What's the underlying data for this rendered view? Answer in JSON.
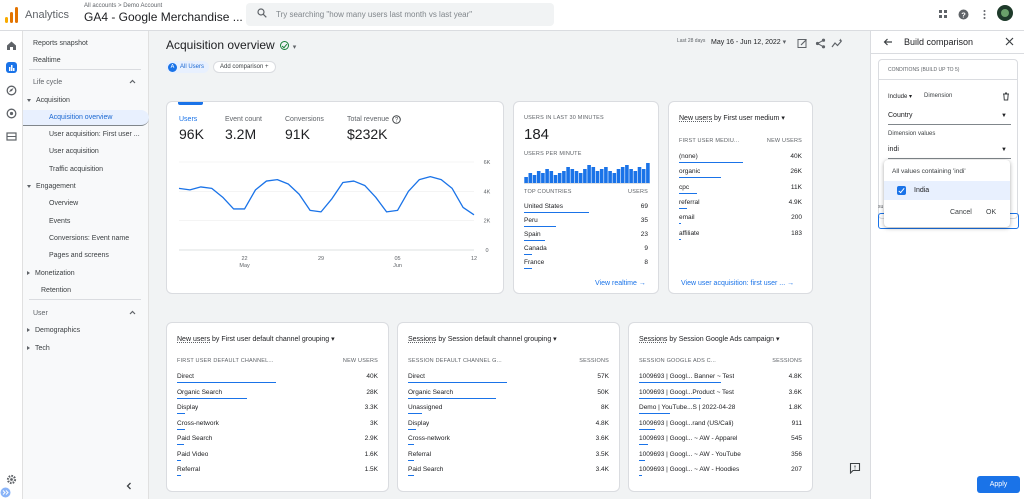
{
  "topbar": {
    "app_name": "Analytics",
    "breadcrumb": "All accounts > Demo Account",
    "property": "GA4 - Google Merchandise ...",
    "search_placeholder": "Try searching \"how many users last month vs last year\""
  },
  "nav": {
    "items": [
      {
        "label": "Reports snapshot",
        "type": "item"
      },
      {
        "label": "Realtime",
        "type": "item"
      },
      {
        "label": "Life cycle",
        "type": "header"
      },
      {
        "label": "Acquisition",
        "type": "group",
        "open": true
      },
      {
        "label": "Acquisition overview",
        "type": "sub",
        "selected": true
      },
      {
        "label": "User acquisition: First user ...",
        "type": "sub"
      },
      {
        "label": "User acquisition",
        "type": "sub"
      },
      {
        "label": "Traffic acquisition",
        "type": "sub"
      },
      {
        "label": "Engagement",
        "type": "group",
        "open": true
      },
      {
        "label": "Overview",
        "type": "sub"
      },
      {
        "label": "Events",
        "type": "sub"
      },
      {
        "label": "Conversions: Event name",
        "type": "sub"
      },
      {
        "label": "Pages and screens",
        "type": "sub"
      },
      {
        "label": "Monetization",
        "type": "group",
        "open": false
      },
      {
        "label": "Retention",
        "type": "plain"
      },
      {
        "label": "User",
        "type": "header"
      },
      {
        "label": "Demographics",
        "type": "group",
        "open": false
      },
      {
        "label": "Tech",
        "type": "group",
        "open": false
      }
    ]
  },
  "page": {
    "title": "Acquisition overview",
    "all_users": "All Users",
    "all_users_letter": "A",
    "add_comparison": "Add comparison",
    "date_prefix": "Last 28 days",
    "date_range": "May 16 - Jun 12, 2022"
  },
  "metrics": [
    {
      "label": "Users",
      "value": "96K"
    },
    {
      "label": "Event count",
      "value": "3.2M"
    },
    {
      "label": "Conversions",
      "value": "91K"
    },
    {
      "label": "Total revenue",
      "value": "$232K"
    }
  ],
  "main_chart": {
    "y_ticks": [
      "6K",
      "4K",
      "2K",
      "0"
    ],
    "x_ticks": [
      {
        "d": "22",
        "m": "May"
      },
      {
        "d": "29",
        "m": ""
      },
      {
        "d": "05",
        "m": "Jun"
      },
      {
        "d": "12",
        "m": ""
      }
    ]
  },
  "chart_data": {
    "type": "line",
    "x": [
      "May 16",
      "May 17",
      "May 18",
      "May 19",
      "May 20",
      "May 21",
      "May 22",
      "May 23",
      "May 24",
      "May 25",
      "May 26",
      "May 27",
      "May 28",
      "May 29",
      "May 30",
      "May 31",
      "Jun 1",
      "Jun 2",
      "Jun 3",
      "Jun 4",
      "Jun 5",
      "Jun 6",
      "Jun 7",
      "Jun 8",
      "Jun 9",
      "Jun 10",
      "Jun 11",
      "Jun 12"
    ],
    "series": [
      {
        "name": "Users",
        "values": [
          4200,
          4100,
          4300,
          4200,
          3600,
          2800,
          2800,
          4100,
          4700,
          4800,
          4500,
          3800,
          2700,
          2600,
          3500,
          4600,
          4700,
          4400,
          3600,
          2600,
          2700,
          4000,
          4800,
          5000,
          4800,
          4200,
          2900,
          2400
        ]
      }
    ],
    "ylim": [
      0,
      6000
    ]
  },
  "realtime": {
    "title": "USERS IN LAST 30 MINUTES",
    "value": "184",
    "per_minute": "USERS PER MINUTE",
    "minute_bars": [
      3,
      5,
      4,
      6,
      5,
      7,
      6,
      4,
      5,
      6,
      8,
      7,
      6,
      5,
      7,
      9,
      8,
      6,
      7,
      8,
      6,
      5,
      7,
      8,
      9,
      7,
      6,
      8,
      7,
      10
    ],
    "col_country": "TOP COUNTRIES",
    "col_users": "USERS",
    "rows": [
      {
        "k": "United States",
        "v": "69",
        "p": 1.0
      },
      {
        "k": "Peru",
        "v": "35",
        "p": 0.5
      },
      {
        "k": "Spain",
        "v": "23",
        "p": 0.33
      },
      {
        "k": "Canada",
        "v": "9",
        "p": 0.13
      },
      {
        "k": "France",
        "v": "8",
        "p": 0.12
      }
    ],
    "link": "View realtime"
  },
  "medium": {
    "title_metric": "New users",
    "title_dim": "by First user medium",
    "col_dim": "FIRST USER MEDIU...",
    "col_val": "NEW USERS",
    "rows": [
      {
        "k": "(none)",
        "v": "40K",
        "p": 1.0
      },
      {
        "k": "organic",
        "v": "26K",
        "p": 0.65
      },
      {
        "k": "cpc",
        "v": "11K",
        "p": 0.28
      },
      {
        "k": "referral",
        "v": "4.9K",
        "p": 0.12
      },
      {
        "k": "email",
        "v": "200",
        "p": 0.01
      },
      {
        "k": "affiliate",
        "v": "183",
        "p": 0.01
      }
    ],
    "link": "View user acquisition: first user ..."
  },
  "channel": {
    "title_metric": "New users",
    "title_dim": "by First user default channel grouping",
    "col_dim": "FIRST USER DEFAULT CHANNEL...",
    "col_val": "NEW USERS",
    "rows": [
      {
        "k": "Direct",
        "v": "40K",
        "p": 1.0
      },
      {
        "k": "Organic Search",
        "v": "28K",
        "p": 0.7
      },
      {
        "k": "Display",
        "v": "3.3K",
        "p": 0.08
      },
      {
        "k": "Cross-network",
        "v": "3K",
        "p": 0.08
      },
      {
        "k": "Paid Search",
        "v": "2.9K",
        "p": 0.07
      },
      {
        "k": "Paid Video",
        "v": "1.6K",
        "p": 0.04
      },
      {
        "k": "Referral",
        "v": "1.5K",
        "p": 0.04
      }
    ]
  },
  "sessions": {
    "title_metric": "Sessions",
    "title_dim": "by Session default channel grouping",
    "col_dim": "SESSION DEFAULT CHANNEL G...",
    "col_val": "SESSIONS",
    "rows": [
      {
        "k": "Direct",
        "v": "57K",
        "p": 1.0
      },
      {
        "k": "Organic Search",
        "v": "50K",
        "p": 0.88
      },
      {
        "k": "Unassigned",
        "v": "8K",
        "p": 0.14
      },
      {
        "k": "Display",
        "v": "4.8K",
        "p": 0.08
      },
      {
        "k": "Cross-network",
        "v": "3.6K",
        "p": 0.06
      },
      {
        "k": "Referral",
        "v": "3.5K",
        "p": 0.06
      },
      {
        "k": "Paid Search",
        "v": "3.4K",
        "p": 0.06
      }
    ]
  },
  "campaign": {
    "title_metric": "Sessions",
    "title_dim": "by Session Google Ads campaign",
    "col_dim": "SESSION GOOGLE ADS C...",
    "col_val": "SESSIONS",
    "rows": [
      {
        "k": "1009693 | Googl... Banner ~ Test",
        "v": "4.8K",
        "p": 1.0
      },
      {
        "k": "1009693 | Googl...Product ~ Test",
        "v": "3.6K",
        "p": 0.75
      },
      {
        "k": "Demo | YouTube...S | 2022-04-28",
        "v": "1.8K",
        "p": 0.38
      },
      {
        "k": "1009693 | Googl...rand (US/Cali)",
        "v": "911",
        "p": 0.19
      },
      {
        "k": "1009693 | Googl... ~ AW - Apparel",
        "v": "545",
        "p": 0.11
      },
      {
        "k": "1009693 | Googl... ~ AW - YouTube",
        "v": "356",
        "p": 0.07
      },
      {
        "k": "1009693 | Googl... ~ AW - Hoodies",
        "v": "207",
        "p": 0.04
      }
    ]
  },
  "panel": {
    "title": "Build comparison",
    "conditions": "CONDITIONS (BUILD UP TO 5)",
    "include": "Include",
    "dimension": "Dimension",
    "dimension_value": "Country",
    "dimension_values_label": "Dimension values",
    "search_value": "indi",
    "all_values": "All values containing 'indi'",
    "option": "India",
    "cancel": "Cancel",
    "ok": "OK",
    "apply": "Apply",
    "partial_label": "su"
  },
  "colors": {
    "accent": "#1a73e8",
    "logo": [
      "#f9ab00",
      "#e37400",
      "#e37400"
    ]
  }
}
